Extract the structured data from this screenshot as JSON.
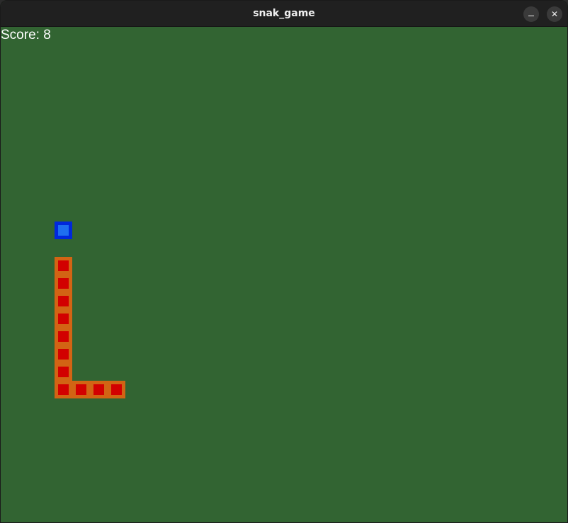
{
  "window": {
    "title": "snak_game",
    "minimize_glyph": "minimize-icon",
    "close_glyph": "✕"
  },
  "hud": {
    "score_label": "Score: ",
    "score_value": "8"
  },
  "game": {
    "grid_cell": 25,
    "colors": {
      "background": "#326432",
      "snake_border": "#d26414",
      "snake_fill": "#d20000",
      "food_border": "#0028dc",
      "food_fill": "#1e6ef0"
    },
    "food": {
      "col": 3,
      "row": 11
    },
    "snake": [
      {
        "col": 6,
        "row": 20
      },
      {
        "col": 5,
        "row": 20
      },
      {
        "col": 4,
        "row": 20
      },
      {
        "col": 3,
        "row": 20
      },
      {
        "col": 3,
        "row": 19
      },
      {
        "col": 3,
        "row": 18
      },
      {
        "col": 3,
        "row": 17
      },
      {
        "col": 3,
        "row": 16
      },
      {
        "col": 3,
        "row": 15
      },
      {
        "col": 3,
        "row": 14
      },
      {
        "col": 3,
        "row": 13
      }
    ]
  }
}
